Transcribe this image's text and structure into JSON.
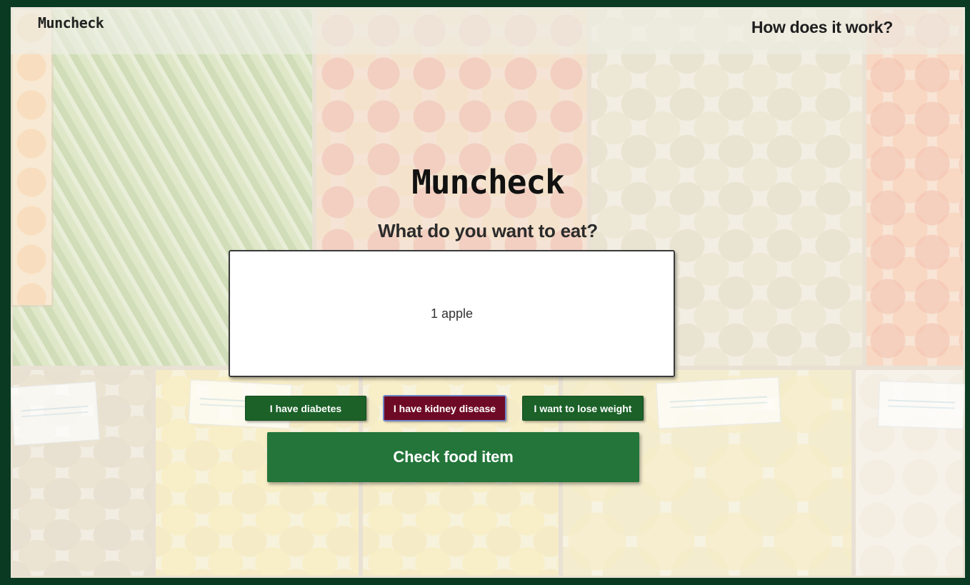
{
  "header": {
    "brand": "Muncheck",
    "how_link": "How does it work?"
  },
  "main": {
    "title": "Muncheck",
    "prompt": "What do you want to eat?",
    "food_input": {
      "value": "1 apple"
    },
    "conditions": [
      {
        "label": "I have diabetes",
        "selected": false
      },
      {
        "label": "I have kidney disease",
        "selected": true
      },
      {
        "label": "I want to lose weight",
        "selected": false
      }
    ],
    "check_button": "Check food item"
  },
  "colors": {
    "page_border": "#0b3a22",
    "button_green": "#1b6128",
    "button_selected": "#6e0a25",
    "check_button": "#23753a"
  }
}
